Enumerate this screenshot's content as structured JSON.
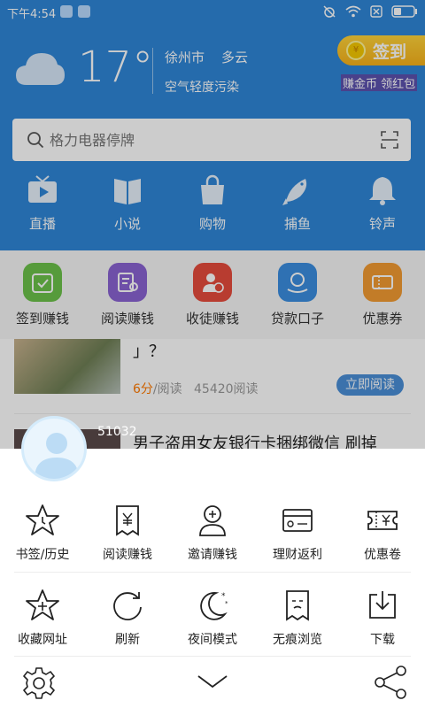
{
  "status_bar": {
    "time": "下午4:54"
  },
  "weather": {
    "temperature": "17°",
    "city": "徐州市",
    "condition": "多云",
    "air_quality": "空气轻度污染"
  },
  "signin": {
    "label": "签到",
    "sub": "赚金币 领红包",
    "coin_symbol": "¥"
  },
  "search": {
    "placeholder": "格力电器停牌"
  },
  "top_nav": [
    {
      "label": "直播",
      "icon": "tv-icon"
    },
    {
      "label": "小说",
      "icon": "book-icon"
    },
    {
      "label": "购物",
      "icon": "shopping-bag-icon"
    },
    {
      "label": "捕鱼",
      "icon": "fish-icon"
    },
    {
      "label": "铃声",
      "icon": "bell-icon"
    }
  ],
  "quick_tools": [
    {
      "label": "签到赚钱",
      "icon": "calendar-check-icon",
      "color": "#6cc24a"
    },
    {
      "label": "阅读赚钱",
      "icon": "reading-icon",
      "color": "#8a63d2"
    },
    {
      "label": "收徒赚钱",
      "icon": "apprentice-icon",
      "color": "#e74c3c"
    },
    {
      "label": "贷款口子",
      "icon": "loan-icon",
      "color": "#3b8ee0"
    },
    {
      "label": "优惠券",
      "icon": "coupon-icon",
      "color": "#f39c33"
    }
  ],
  "feed": {
    "item1": {
      "title_tail": "」？",
      "read_time": "6分",
      "read_time_suffix": "/阅读",
      "read_count": "45420阅读",
      "action": "立即阅读"
    },
    "item2": {
      "title": "男子盗用女友银行卡捆绑微信 刷掉"
    }
  },
  "user": {
    "id": "51032"
  },
  "menu": {
    "row1": [
      {
        "label": "书签/历史",
        "icon": "star-icon"
      },
      {
        "label": "阅读赚钱",
        "icon": "receipt-yen-icon"
      },
      {
        "label": "邀请赚钱",
        "icon": "invite-user-icon"
      },
      {
        "label": "理财返利",
        "icon": "credit-card-icon"
      },
      {
        "label": "优惠卷",
        "icon": "ticket-icon"
      }
    ],
    "row2": [
      {
        "label": "收藏网址",
        "icon": "star-plus-icon"
      },
      {
        "label": "刷新",
        "icon": "refresh-icon"
      },
      {
        "label": "夜间模式",
        "icon": "moon-icon"
      },
      {
        "label": "无痕浏览",
        "icon": "incognito-icon"
      },
      {
        "label": "下载",
        "icon": "download-icon"
      }
    ]
  }
}
